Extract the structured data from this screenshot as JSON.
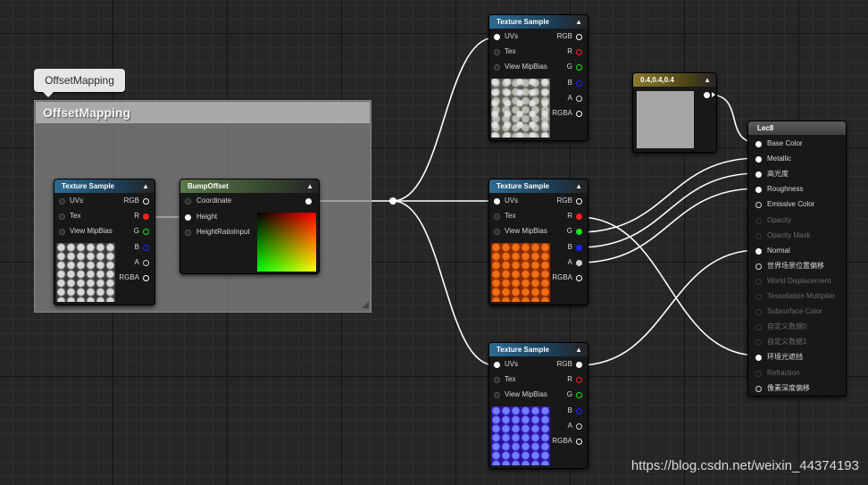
{
  "comment": {
    "tab_label": "OffsetMapping",
    "title": "OffsetMapping"
  },
  "texture_sample": {
    "title": "Texture Sample",
    "inputs": [
      "UVs",
      "Tex",
      "View MipBias"
    ],
    "outputs": [
      "RGB",
      "R",
      "G",
      "B",
      "A",
      "RGBA"
    ]
  },
  "bump_offset": {
    "title": "BumpOffset",
    "inputs": [
      "Coordinate",
      "Height",
      "HeightRatioInput"
    ]
  },
  "constant": {
    "title": "0.4,0.4,0.4"
  },
  "material": {
    "title": "Lec8",
    "inputs": [
      "Base Color",
      "Metallic",
      "高光度",
      "Roughness",
      "Emissive Color",
      "Opacity",
      "Opacity Mask",
      "Normal",
      "世界场景位置偏移",
      "World Displacement",
      "Tessellation Multiplier",
      "Subsurface Color",
      "自定义数据0",
      "自定义数据1",
      "环境光遮挡",
      "Refraction",
      "像素深度偏移"
    ]
  },
  "pin_colors": {
    "R": "#ff2020",
    "G": "#20e020",
    "B": "#2020ff",
    "A": "#d0d0d0",
    "white": "#ffffff"
  },
  "icons": [
    "collapse-arrow-icon",
    "resize-grip-icon"
  ],
  "watermark": "https://blog.csdn.net/weixin_44374193"
}
